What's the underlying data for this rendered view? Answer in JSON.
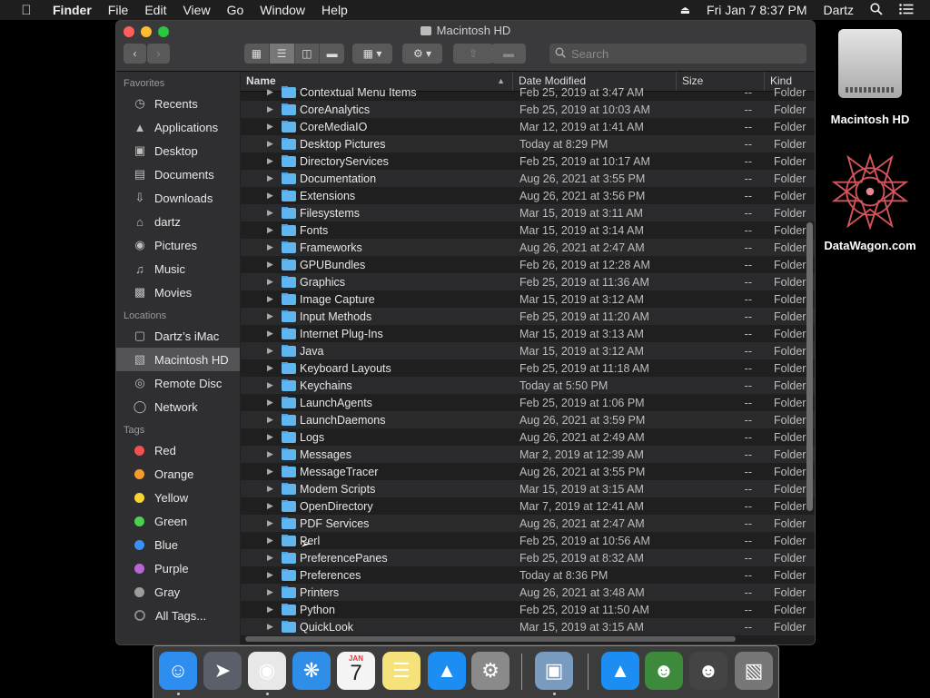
{
  "menubar": {
    "app": "Finder",
    "items": [
      "File",
      "Edit",
      "View",
      "Go",
      "Window",
      "Help"
    ],
    "datetime": "Fri Jan 7  8:37 PM",
    "user": "Dartz"
  },
  "window": {
    "title": "Macintosh HD",
    "search_placeholder": "Search"
  },
  "sidebar": {
    "favorites_label": "Favorites",
    "favorites": [
      {
        "label": "Recents",
        "icon": "clock-icon"
      },
      {
        "label": "Applications",
        "icon": "applications-icon"
      },
      {
        "label": "Desktop",
        "icon": "desktop-icon"
      },
      {
        "label": "Documents",
        "icon": "document-icon"
      },
      {
        "label": "Downloads",
        "icon": "download-icon"
      },
      {
        "label": "dartz",
        "icon": "home-icon"
      },
      {
        "label": "Pictures",
        "icon": "camera-icon"
      },
      {
        "label": "Music",
        "icon": "music-note-icon"
      },
      {
        "label": "Movies",
        "icon": "film-icon"
      }
    ],
    "locations_label": "Locations",
    "locations": [
      {
        "label": "Dartz’s iMac",
        "icon": "imac-icon"
      },
      {
        "label": "Macintosh HD",
        "icon": "hard-drive-icon"
      },
      {
        "label": "Remote Disc",
        "icon": "disc-icon"
      },
      {
        "label": "Network",
        "icon": "globe-icon"
      }
    ],
    "tags_label": "Tags",
    "tags": [
      {
        "label": "Red",
        "color": "#f0524f"
      },
      {
        "label": "Orange",
        "color": "#f49a2f"
      },
      {
        "label": "Yellow",
        "color": "#f6d434"
      },
      {
        "label": "Green",
        "color": "#4fce52"
      },
      {
        "label": "Blue",
        "color": "#3c8ff4"
      },
      {
        "label": "Purple",
        "color": "#b865d6"
      },
      {
        "label": "Gray",
        "color": "#9c9c9c"
      },
      {
        "label": "All Tags...",
        "color": ""
      }
    ]
  },
  "columns": {
    "name": "Name",
    "date": "Date Modified",
    "size": "Size",
    "kind": "Kind"
  },
  "files": [
    {
      "name": "Contextual Menu Items",
      "date": "Feb 25, 2019 at 3:47 AM",
      "size": "--",
      "kind": "Folder"
    },
    {
      "name": "CoreAnalytics",
      "date": "Feb 25, 2019 at 10:03 AM",
      "size": "--",
      "kind": "Folder"
    },
    {
      "name": "CoreMediaIO",
      "date": "Mar 12, 2019 at 1:41 AM",
      "size": "--",
      "kind": "Folder"
    },
    {
      "name": "Desktop Pictures",
      "date": "Today at 8:29 PM",
      "size": "--",
      "kind": "Folder"
    },
    {
      "name": "DirectoryServices",
      "date": "Feb 25, 2019 at 10:17 AM",
      "size": "--",
      "kind": "Folder"
    },
    {
      "name": "Documentation",
      "date": "Aug 26, 2021 at 3:55 PM",
      "size": "--",
      "kind": "Folder"
    },
    {
      "name": "Extensions",
      "date": "Aug 26, 2021 at 3:56 PM",
      "size": "--",
      "kind": "Folder"
    },
    {
      "name": "Filesystems",
      "date": "Mar 15, 2019 at 3:11 AM",
      "size": "--",
      "kind": "Folder"
    },
    {
      "name": "Fonts",
      "date": "Mar 15, 2019 at 3:14 AM",
      "size": "--",
      "kind": "Folder"
    },
    {
      "name": "Frameworks",
      "date": "Aug 26, 2021 at 2:47 AM",
      "size": "--",
      "kind": "Folder"
    },
    {
      "name": "GPUBundles",
      "date": "Feb 26, 2019 at 12:28 AM",
      "size": "--",
      "kind": "Folder"
    },
    {
      "name": "Graphics",
      "date": "Feb 25, 2019 at 11:36 AM",
      "size": "--",
      "kind": "Folder"
    },
    {
      "name": "Image Capture",
      "date": "Mar 15, 2019 at 3:12 AM",
      "size": "--",
      "kind": "Folder"
    },
    {
      "name": "Input Methods",
      "date": "Feb 25, 2019 at 11:20 AM",
      "size": "--",
      "kind": "Folder"
    },
    {
      "name": "Internet Plug-Ins",
      "date": "Mar 15, 2019 at 3:13 AM",
      "size": "--",
      "kind": "Folder"
    },
    {
      "name": "Java",
      "date": "Mar 15, 2019 at 3:12 AM",
      "size": "--",
      "kind": "Folder"
    },
    {
      "name": "Keyboard Layouts",
      "date": "Feb 25, 2019 at 11:18 AM",
      "size": "--",
      "kind": "Folder"
    },
    {
      "name": "Keychains",
      "date": "Today at 5:50 PM",
      "size": "--",
      "kind": "Folder"
    },
    {
      "name": "LaunchAgents",
      "date": "Feb 25, 2019 at 1:06 PM",
      "size": "--",
      "kind": "Folder"
    },
    {
      "name": "LaunchDaemons",
      "date": "Aug 26, 2021 at 3:59 PM",
      "size": "--",
      "kind": "Folder"
    },
    {
      "name": "Logs",
      "date": "Aug 26, 2021 at 2:49 AM",
      "size": "--",
      "kind": "Folder"
    },
    {
      "name": "Messages",
      "date": "Mar 2, 2019 at 12:39 AM",
      "size": "--",
      "kind": "Folder"
    },
    {
      "name": "MessageTracer",
      "date": "Aug 26, 2021 at 3:55 PM",
      "size": "--",
      "kind": "Folder"
    },
    {
      "name": "Modem Scripts",
      "date": "Mar 15, 2019 at 3:15 AM",
      "size": "--",
      "kind": "Folder"
    },
    {
      "name": "OpenDirectory",
      "date": "Mar 7, 2019 at 12:41 AM",
      "size": "--",
      "kind": "Folder"
    },
    {
      "name": "PDF Services",
      "date": "Aug 26, 2021 at 2:47 AM",
      "size": "--",
      "kind": "Folder"
    },
    {
      "name": "Perl",
      "date": "Feb 25, 2019 at 10:56 AM",
      "size": "--",
      "kind": "Folder"
    },
    {
      "name": "PreferencePanes",
      "date": "Feb 25, 2019 at 8:32 AM",
      "size": "--",
      "kind": "Folder"
    },
    {
      "name": "Preferences",
      "date": "Today at 8:36 PM",
      "size": "--",
      "kind": "Folder"
    },
    {
      "name": "Printers",
      "date": "Aug 26, 2021 at 3:48 AM",
      "size": "--",
      "kind": "Folder"
    },
    {
      "name": "Python",
      "date": "Feb 25, 2019 at 11:50 AM",
      "size": "--",
      "kind": "Folder"
    },
    {
      "name": "QuickLook",
      "date": "Mar 15, 2019 at 3:15 AM",
      "size": "--",
      "kind": "Folder"
    }
  ],
  "desktop": [
    {
      "label": "Macintosh HD",
      "icon": "hard-drive-icon"
    },
    {
      "label": "DataWagon.com",
      "icon": "star-logo-icon"
    }
  ],
  "dock": [
    {
      "name": "finder",
      "icon": "finder-icon",
      "color": "#2d8ef0",
      "running": true
    },
    {
      "name": "launchpad",
      "icon": "rocket-icon",
      "color": "#5a5f69",
      "running": false
    },
    {
      "name": "chrome",
      "icon": "chrome-icon",
      "color": "#e8e8e8",
      "running": true
    },
    {
      "name": "safari",
      "icon": "compass-icon",
      "color": "#2f8fe8",
      "running": false
    },
    {
      "name": "calendar",
      "icon": "calendar-icon",
      "color": "#f4f4f4",
      "running": false
    },
    {
      "name": "notes",
      "icon": "notes-icon",
      "color": "#f6e27a",
      "running": false
    },
    {
      "name": "app-store",
      "icon": "app-store-icon",
      "color": "#1c8df2",
      "running": false
    },
    {
      "name": "system-preferences",
      "icon": "gear-icon",
      "color": "#8a8a8a",
      "running": false
    },
    {
      "name": "preview",
      "icon": "preview-icon",
      "color": "#7a9bc0",
      "running": true
    },
    {
      "name": "app-store-2",
      "icon": "app-store-icon",
      "color": "#1c8df2",
      "running": false
    },
    {
      "name": "lemmings",
      "icon": "game-icon",
      "color": "#3d8a3d",
      "running": false
    },
    {
      "name": "lemmings-2",
      "icon": "game-icon",
      "color": "#444",
      "running": false
    },
    {
      "name": "trash",
      "icon": "trash-icon",
      "color": "#777",
      "running": false
    }
  ],
  "calendar_icon": {
    "month": "JAN",
    "day": "7"
  }
}
